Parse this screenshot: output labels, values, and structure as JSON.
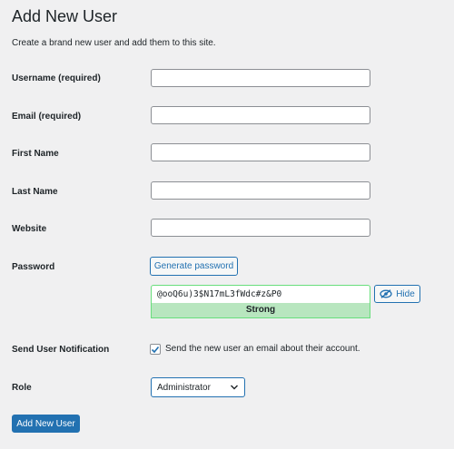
{
  "page": {
    "title": "Add New User",
    "description": "Create a brand new user and add them to this site."
  },
  "form": {
    "username": {
      "label": "Username (required)",
      "value": ""
    },
    "email": {
      "label": "Email (required)",
      "value": ""
    },
    "first_name": {
      "label": "First Name",
      "value": ""
    },
    "last_name": {
      "label": "Last Name",
      "value": ""
    },
    "website": {
      "label": "Website",
      "value": ""
    },
    "password": {
      "label": "Password",
      "generate_label": "Generate password",
      "value": "@ooQ6u)3$N17mL3fWdc#z&P0",
      "strength": "Strong",
      "hide_label": "Hide"
    },
    "notification": {
      "label": "Send User Notification",
      "checked": true,
      "checkbox_text": "Send the new user an email about their account."
    },
    "role": {
      "label": "Role",
      "selected": "Administrator"
    },
    "submit_label": "Add New User"
  },
  "colors": {
    "accent": "#2271b1",
    "strength_bg": "#b8e6bf",
    "strength_border": "#68de7c",
    "background": "#f0f0f1"
  },
  "icons": {
    "hide": "eye-slash-icon",
    "check": "checkmark-icon",
    "chevron": "chevron-down-icon"
  }
}
